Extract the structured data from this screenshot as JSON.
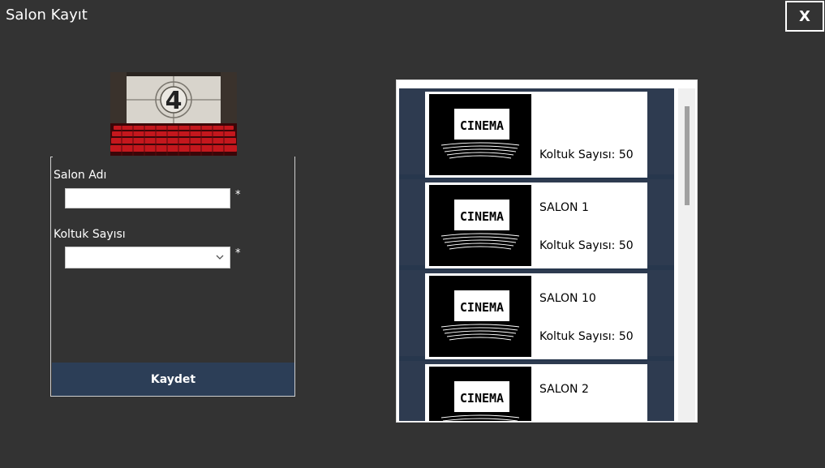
{
  "window": {
    "title": "Salon Kayıt",
    "close_label": "X"
  },
  "form": {
    "banner_icon": "cinema-screen-icon",
    "banner_digit": "4",
    "salon_adi_label": "Salon Adı",
    "salon_adi_value": "",
    "koltuk_sayisi_label": "Koltuk Sayısı",
    "koltuk_sayisi_value": "",
    "required_mark": "*",
    "save_label": "Kaydet"
  },
  "salon_list": {
    "items": [
      {
        "name": "",
        "seats_label": "Koltuk Sayısı: 50",
        "logo_text": "CINEMA"
      },
      {
        "name": "SALON 1",
        "seats_label": "Koltuk Sayısı: 50",
        "logo_text": "CINEMA"
      },
      {
        "name": "SALON 10",
        "seats_label": "Koltuk Sayısı: 50",
        "logo_text": "CINEMA"
      },
      {
        "name": "SALON 2",
        "seats_label": "",
        "logo_text": "CINEMA"
      }
    ]
  },
  "colors": {
    "background": "#333333",
    "accent": "#2c3e57",
    "list_bg": "#27374d"
  }
}
